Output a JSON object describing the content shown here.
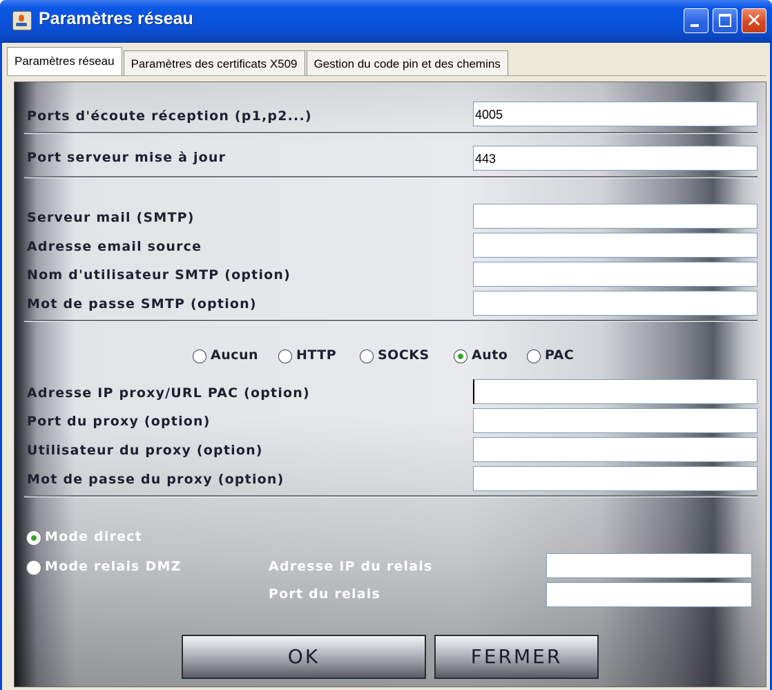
{
  "window": {
    "title": "Paramètres réseau",
    "icon": "java-coffee-icon"
  },
  "tabs": [
    {
      "label": "Paramètres réseau",
      "active": true
    },
    {
      "label": "Paramètres des certificats X509",
      "active": false
    },
    {
      "label": "Gestion du code pin et des chemins",
      "active": false
    }
  ],
  "ports": {
    "listen_label": "Ports d'écoute réception (p1,p2...)",
    "listen_value": "4005",
    "update_label": "Port serveur mise à jour",
    "update_value": "443"
  },
  "smtp": {
    "server_label": "Serveur mail (SMTP)",
    "server_value": "",
    "source_email_label": "Adresse email source",
    "source_email_value": "",
    "user_label": "Nom d'utilisateur SMTP (option)",
    "user_value": "",
    "password_label": "Mot de passe SMTP (option)",
    "password_value": ""
  },
  "proxy": {
    "modes": [
      "Aucun",
      "HTTP",
      "SOCKS",
      "Auto",
      "PAC"
    ],
    "selected_mode": "Auto",
    "address_label": "Adresse IP proxy/URL PAC (option)",
    "address_value": "",
    "port_label": "Port du proxy (option)",
    "port_value": "",
    "user_label": "Utilisateur du proxy (option)",
    "user_value": "",
    "password_label": "Mot de passe du proxy (option)",
    "password_value": ""
  },
  "connection": {
    "direct_label": "Mode direct",
    "relay_label": "Mode relais DMZ",
    "selected": "direct",
    "relay_ip_label": "Adresse IP du relais",
    "relay_ip_value": "",
    "relay_port_label": "Port du relais",
    "relay_port_value": ""
  },
  "buttons": {
    "ok": "OK",
    "close": "FERMER"
  },
  "colors": {
    "titlebar": "#0a57e6",
    "window_bg": "#ece9d8",
    "label_text": "#1e2030",
    "radio_selected": "#35a52c"
  }
}
